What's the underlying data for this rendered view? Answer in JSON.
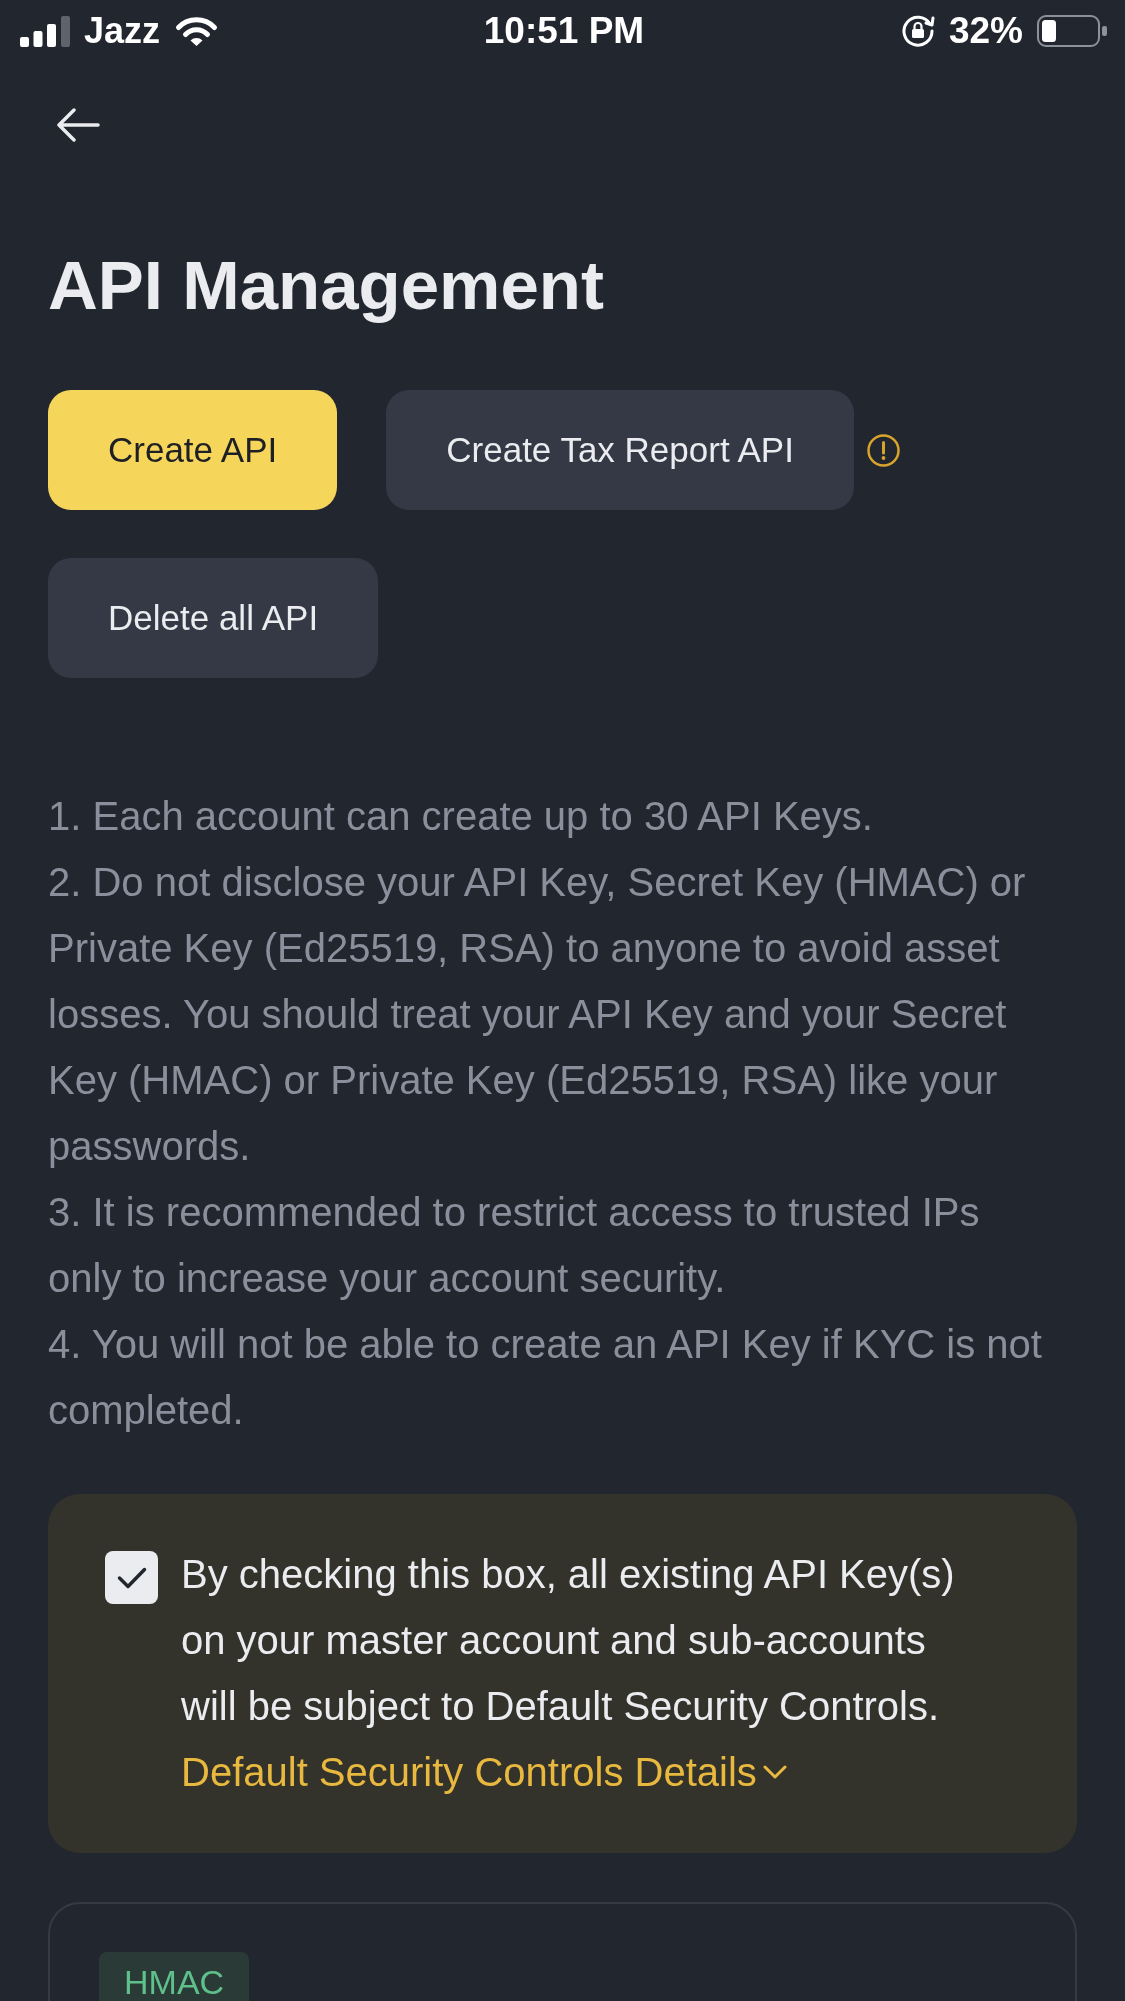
{
  "status_bar": {
    "carrier": "Jazz",
    "time": "10:51 PM",
    "battery": "32%"
  },
  "header": {
    "title": "API Management"
  },
  "actions": [
    {
      "label": "Create API",
      "kind": "primary",
      "has_info_icon": false
    },
    {
      "label": "Create Tax Report API",
      "kind": "secondary",
      "has_info_icon": true
    },
    {
      "label": "Delete all API",
      "kind": "secondary",
      "has_info_icon": false
    }
  ],
  "notes": [
    "1. Each account can create up to 30 API Keys.",
    "2. Do not disclose your API Key, Secret Key (HMAC) or Private Key (Ed25519, RSA) to anyone to avoid asset losses. You should treat your API Key and your Secret Key (HMAC) or Private Key (Ed25519, RSA) like your passwords.",
    "3. It is recommended to restrict access to trusted IPs only to increase your account security.",
    "4. You will not be able to create an API Key if KYC is not completed."
  ],
  "security_notice": {
    "checked": true,
    "text": "By checking this box, all existing API Key(s) on your master account and sub-accounts will be subject to Default Security Controls.",
    "link": "Default Security Controls Details"
  },
  "api_keys": [
    {
      "type": "HMAC"
    }
  ]
}
